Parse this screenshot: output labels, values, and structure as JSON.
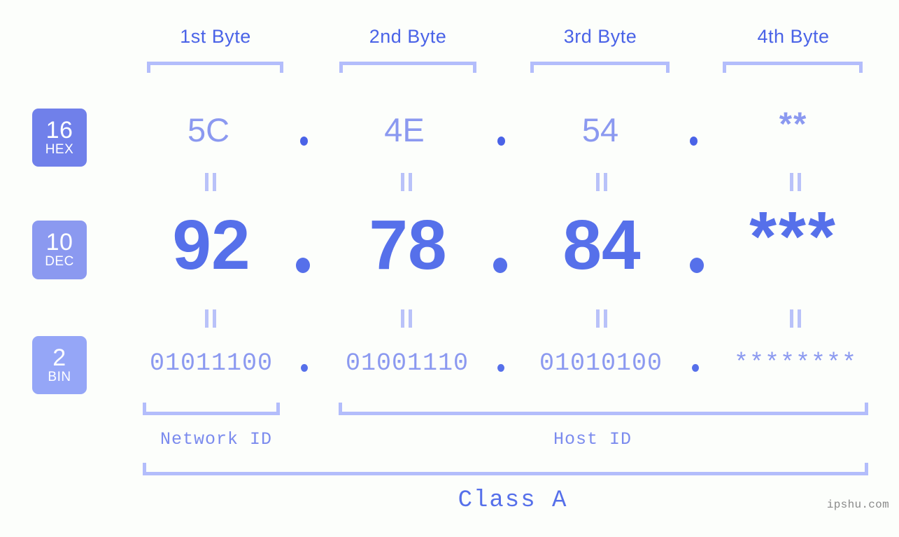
{
  "palette": {
    "background": "#fcfefb",
    "accent_strong": "#4a63e7",
    "accent_mid": "#5670ea",
    "accent_light": "#8b99f0",
    "bracket": "#b3bdfb",
    "badge_hex": "#7080ea",
    "badge_dec": "#8b99f0",
    "badge_bin": "#95a6f7",
    "watermark": "#8a8a8a"
  },
  "byte_headers": [
    {
      "label": "1st Byte"
    },
    {
      "label": "2nd Byte"
    },
    {
      "label": "3rd Byte"
    },
    {
      "label": "4th Byte"
    }
  ],
  "rows": {
    "hex": {
      "badge_number": "16",
      "badge_name": "HEX",
      "values": [
        "5C",
        "4E",
        "54",
        "**"
      ],
      "separator": "."
    },
    "dec": {
      "badge_number": "10",
      "badge_name": "DEC",
      "values": [
        "92",
        "78",
        "84",
        "***"
      ],
      "separator": "."
    },
    "bin": {
      "badge_number": "2",
      "badge_name": "BIN",
      "values": [
        "01011100",
        "01001110",
        "01010100",
        "********"
      ],
      "separator": "."
    }
  },
  "equality_marks": {
    "glyph": "=",
    "count_per_row": 4,
    "rows": 2
  },
  "segments": {
    "network_id": "Network ID",
    "host_id": "Host ID",
    "class": "Class A"
  },
  "watermark": "ipshu.com"
}
